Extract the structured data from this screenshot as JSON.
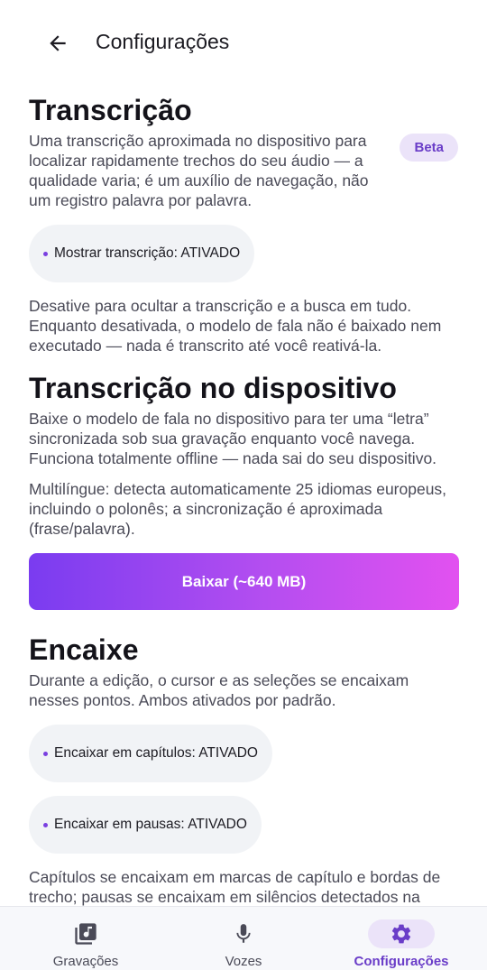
{
  "appbar": {
    "title": "Configurações",
    "back_icon": "arrow-left-icon"
  },
  "transcription": {
    "title": "Transcrição",
    "description": "Uma transcrição aproximada no dispositivo para localizar rapidamente trechos do seu áudio — a qualidade varia; é um auxílio de navegação, não um registro palavra por palavra.",
    "badge": "Beta",
    "toggle_label": "Mostrar transcrição: ATIVADO",
    "note": "Desative para ocultar a transcrição e a busca em tudo. Enquanto desativada, o modelo de fala não é baixado nem executado — nada é transcrito até você reativá-la."
  },
  "on_device": {
    "title": "Transcrição no dispositivo",
    "description": "Baixe o modelo de fala no dispositivo para ter uma “letra” sincronizada sob sua gravação enquanto você navega. Funciona totalmente offline — nada sai do seu dispositivo.",
    "multilingual": "Multilíngue: detecta automaticamente 25 idiomas europeus, incluindo o polonês; a sincronização é aproximada (frase/palavra).",
    "download_label": "Baixar (~640 MB)"
  },
  "snap": {
    "title": "Encaixe",
    "description": "Durante a edição, o cursor e as seleções se encaixam nesses pontos. Ambos ativados por padrão.",
    "chapters_label": "Encaixar em capítulos: ATIVADO",
    "pauses_label": "Encaixar em pausas: ATIVADO",
    "footer_note": "Capítulos se encaixam em marcas de capítulo e bordas de trecho; pausas se encaixam em silêncios detectados na"
  },
  "bottom_nav": {
    "items": [
      {
        "label": "Gravações",
        "icon": "library-music-icon",
        "active": false
      },
      {
        "label": "Vozes",
        "icon": "microphone-icon",
        "active": false
      },
      {
        "label": "Configurações",
        "icon": "gear-icon",
        "active": true
      }
    ]
  },
  "colors": {
    "accent": "#6a3dc8",
    "badge_bg": "#ebe3f9",
    "chip_bg": "#f1f3f6",
    "gradient_start": "#7a3cf0",
    "gradient_end": "#e251f0"
  }
}
